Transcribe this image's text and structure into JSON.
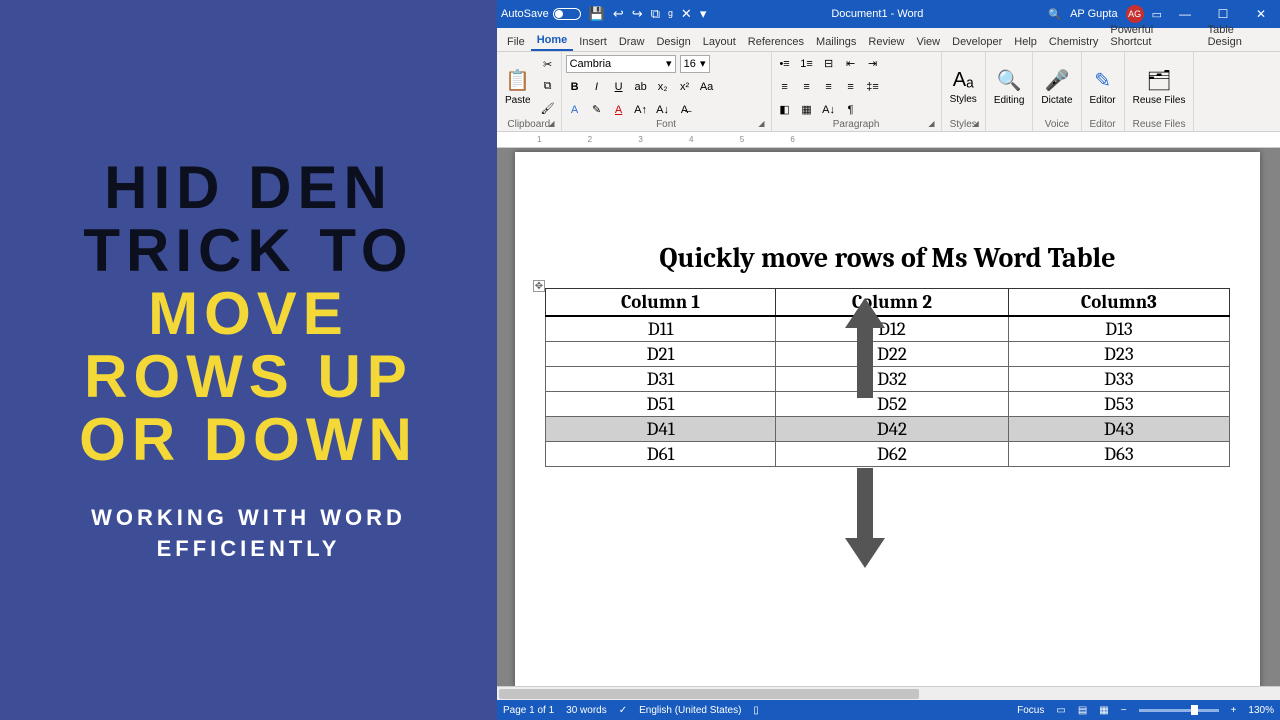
{
  "promo": {
    "line1a": "HID DEN",
    "line1b": "TRICK TO",
    "line2a": "MOVE",
    "line2b": "ROWS UP",
    "line2c": "OR DOWN",
    "sub1": "WORKING WITH WORD",
    "sub2": "EFFICIENTLY"
  },
  "titlebar": {
    "autosave": "AutoSave",
    "doc": "Document1 - Word",
    "user": "AP Gupta",
    "initials": "AG"
  },
  "tabs": [
    "File",
    "Home",
    "Insert",
    "Draw",
    "Design",
    "Layout",
    "References",
    "Mailings",
    "Review",
    "View",
    "Developer",
    "Help",
    "Chemistry",
    "Powerful Shortcut",
    "Table Design"
  ],
  "active_tab": 1,
  "ribbon": {
    "clipboard": "Clipboard",
    "paste": "Paste",
    "fontgrp": "Font",
    "fontname": "Cambria",
    "fontsize": "16",
    "paragrp": "Paragraph",
    "styles": "Styles",
    "editing": "Editing",
    "dictate": "Dictate",
    "voice": "Voice",
    "editor": "Editor",
    "reuse": "Reuse Files",
    "reuselbl": "Reuse Files"
  },
  "ruler": "1 2 3 4 5 6",
  "doc": {
    "heading": "Quickly move rows of Ms Word Table",
    "headers": [
      "Column 1",
      "Column 2",
      "Column3"
    ],
    "rows": [
      [
        "D11",
        "D12",
        "D13"
      ],
      [
        "D21",
        "D22",
        "D23"
      ],
      [
        "D31",
        "D32",
        "D33"
      ],
      [
        "D51",
        "D52",
        "D53"
      ],
      [
        "D41",
        "D42",
        "D43"
      ],
      [
        "D61",
        "D62",
        "D63"
      ]
    ],
    "selected_row": 4
  },
  "status": {
    "page": "Page 1 of 1",
    "words": "30 words",
    "lang": "English (United States)",
    "focus": "Focus",
    "zoom": "130%"
  }
}
